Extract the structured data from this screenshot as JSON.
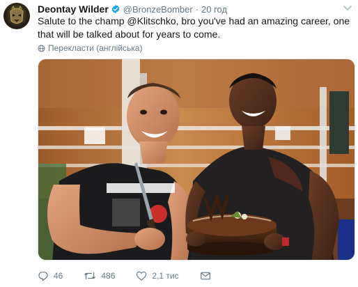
{
  "tweet": {
    "display_name": "Deontay Wilder",
    "verified_icon": "verified-badge-icon",
    "handle": "@BronzeBomber",
    "separator": "·",
    "time": "20 год",
    "text": "Salute to the champ @Klitschko, bro you've had an amazing career, one that will be talked about for years to come.",
    "translate_label": "Перекласти (англійська)",
    "photo_icon": "photo-image",
    "actions": {
      "reply_count": "46",
      "retweet_count": "486",
      "like_count": "2,1 тис"
    }
  },
  "colors": {
    "verified": "#1da1f2",
    "muted": "#657786",
    "text": "#14171a"
  }
}
